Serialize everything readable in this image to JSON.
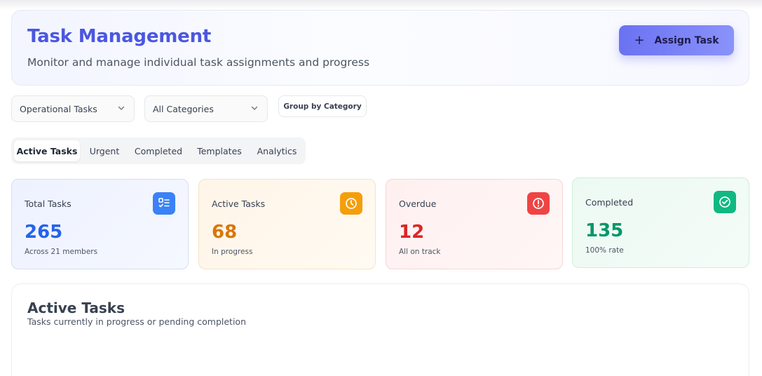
{
  "header": {
    "title": "Task Management",
    "subtitle": "Monitor and manage individual task assignments and progress",
    "assign_label": "Assign Task"
  },
  "filters": {
    "task_type": "Operational Tasks",
    "category": "All Categories",
    "group_label": "Group by Category"
  },
  "tabs": [
    {
      "label": "Active Tasks",
      "active": true
    },
    {
      "label": "Urgent",
      "active": false
    },
    {
      "label": "Completed",
      "active": false
    },
    {
      "label": "Templates",
      "active": false
    },
    {
      "label": "Analytics",
      "active": false
    }
  ],
  "stats": [
    {
      "label": "Total Tasks",
      "value": "265",
      "sub": "Across 21 members",
      "icon": "task-list-icon",
      "color": "#2563eb"
    },
    {
      "label": "Active Tasks",
      "value": "68",
      "sub": "In progress",
      "icon": "clock-icon",
      "color": "#d97706"
    },
    {
      "label": "Overdue",
      "value": "12",
      "sub": "All on track",
      "icon": "alert-circle-icon",
      "color": "#dc2626"
    },
    {
      "label": "Completed",
      "value": "135",
      "sub": "100% rate",
      "icon": "check-circle-icon",
      "color": "#059669"
    }
  ],
  "section": {
    "title": "Active Tasks",
    "subtitle": "Tasks currently in progress or pending completion"
  }
}
